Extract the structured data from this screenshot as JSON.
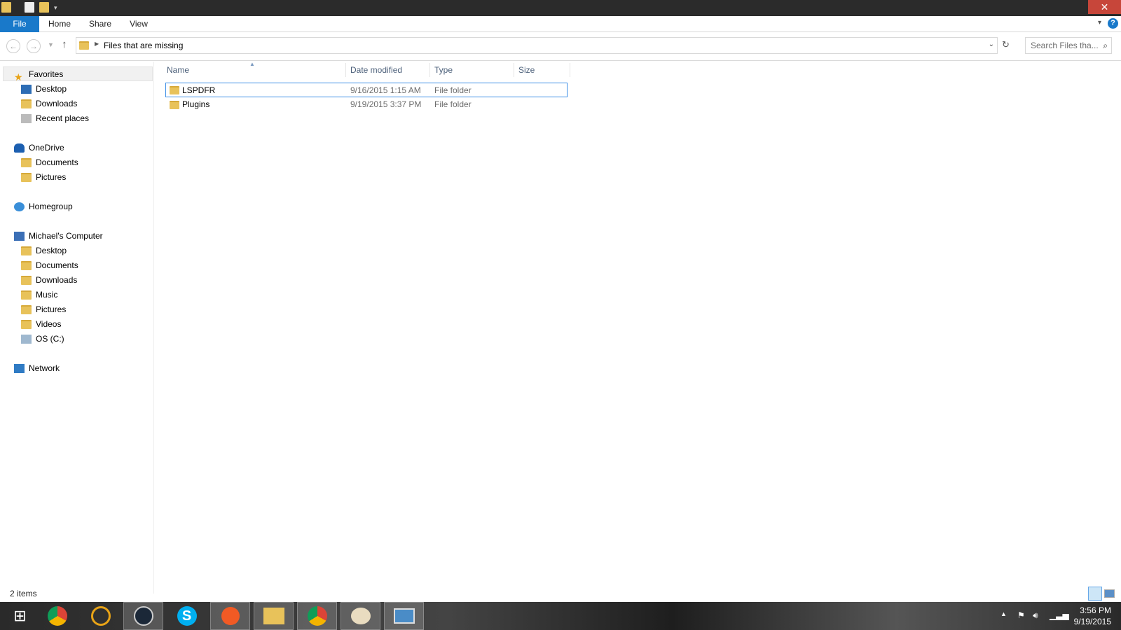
{
  "ribbon": {
    "tabs": [
      "File",
      "Home",
      "Share",
      "View"
    ]
  },
  "window": {
    "close_label": "✕",
    "help_label": "?"
  },
  "address": {
    "path": "Files that are missing"
  },
  "search": {
    "placeholder": "Search Files tha..."
  },
  "sidebar": {
    "favorites": {
      "label": "Favorites",
      "items": [
        "Desktop",
        "Downloads",
        "Recent places"
      ]
    },
    "onedrive": {
      "label": "OneDrive",
      "items": [
        "Documents",
        "Pictures"
      ]
    },
    "homegroup": {
      "label": "Homegroup"
    },
    "computer": {
      "label": "Michael's Computer",
      "items": [
        "Desktop",
        "Documents",
        "Downloads",
        "Music",
        "Pictures",
        "Videos",
        "OS (C:)"
      ]
    },
    "network": {
      "label": "Network"
    }
  },
  "columns": [
    "Name",
    "Date modified",
    "Type",
    "Size"
  ],
  "files": [
    {
      "name": "LSPDFR",
      "date": "9/16/2015 1:15 AM",
      "type": "File folder",
      "size": ""
    },
    {
      "name": "Plugins",
      "date": "9/19/2015 3:37 PM",
      "type": "File folder",
      "size": ""
    }
  ],
  "status": {
    "count": "2 items"
  },
  "taskbar": {
    "apps": [
      "start",
      "chrome",
      "origin",
      "steam",
      "skype",
      "ccleaner",
      "file-explorer",
      "chrome",
      "paint",
      "photos"
    ]
  },
  "clock": {
    "time": "3:56 PM",
    "date": "9/19/2015"
  }
}
